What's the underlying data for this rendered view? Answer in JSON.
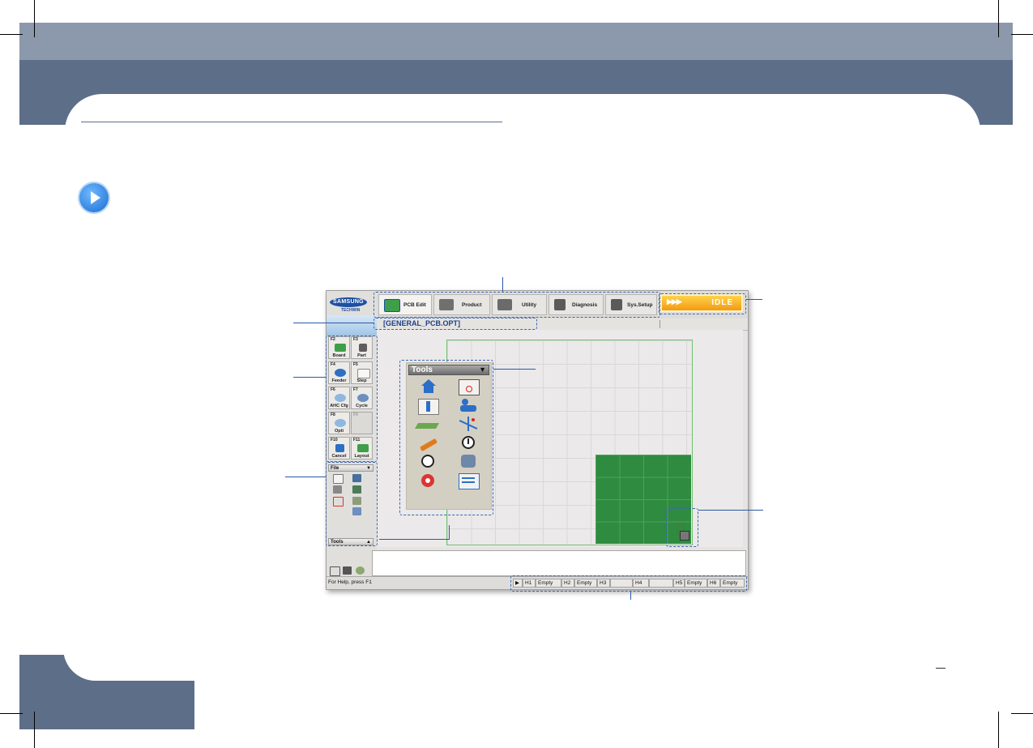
{
  "page": {
    "brand_color": "#5d6e89"
  },
  "app": {
    "logo_text": "SAMSUNG",
    "logo_sub": "TECHWIN",
    "nav": [
      {
        "label": "PCB Edit",
        "icon": "pcb-edit-icon"
      },
      {
        "label": "Product",
        "icon": "product-icon"
      },
      {
        "label": "Utility",
        "icon": "utility-icon"
      },
      {
        "label": "Diagnosis",
        "icon": "diagnosis-icon"
      },
      {
        "label": "Sys.Setup",
        "icon": "sys-setup-icon"
      }
    ],
    "status": {
      "arrows": "▶▶▶",
      "state": "IDLE",
      "color": "#f5a623"
    },
    "file_name": "[GENERAL_PCB.OPT]",
    "fkeys": [
      {
        "key": "F2",
        "label": "Board"
      },
      {
        "key": "F3",
        "label": "Part"
      },
      {
        "key": "F4",
        "label": "Feeder"
      },
      {
        "key": "F5",
        "label": "Step"
      },
      {
        "key": "F6",
        "label": "AHC Cfg"
      },
      {
        "key": "F7",
        "label": "Cycle"
      },
      {
        "key": "F8",
        "label": "Opti"
      },
      {
        "key": "F9",
        "label": ""
      },
      {
        "key": "F10",
        "label": "Cancel"
      },
      {
        "key": "F11",
        "label": "Layout"
      }
    ],
    "file_panel_title": "File",
    "tools_panel_title": "Tools",
    "tools_palette": {
      "title": "Tools",
      "icons": [
        "home-icon",
        "window-target-icon",
        "rotate-icon",
        "operator-icon",
        "conveyor-icon",
        "xyz-axis-icon",
        "nozzle-tool-icon",
        "warning-icon",
        "auto-icon",
        "feeder-icon",
        "settings-gear-icon",
        "list-icon"
      ]
    },
    "status_bar": {
      "help": "For Help, press F1",
      "heads": [
        {
          "name": "H1",
          "value": "Empty"
        },
        {
          "name": "H2",
          "value": "Empty"
        },
        {
          "name": "H3",
          "value": ""
        },
        {
          "name": "H4",
          "value": ""
        },
        {
          "name": "H5",
          "value": "Empty"
        },
        {
          "name": "H6",
          "value": "Empty"
        }
      ]
    },
    "board_color": "#2e8b3f"
  }
}
